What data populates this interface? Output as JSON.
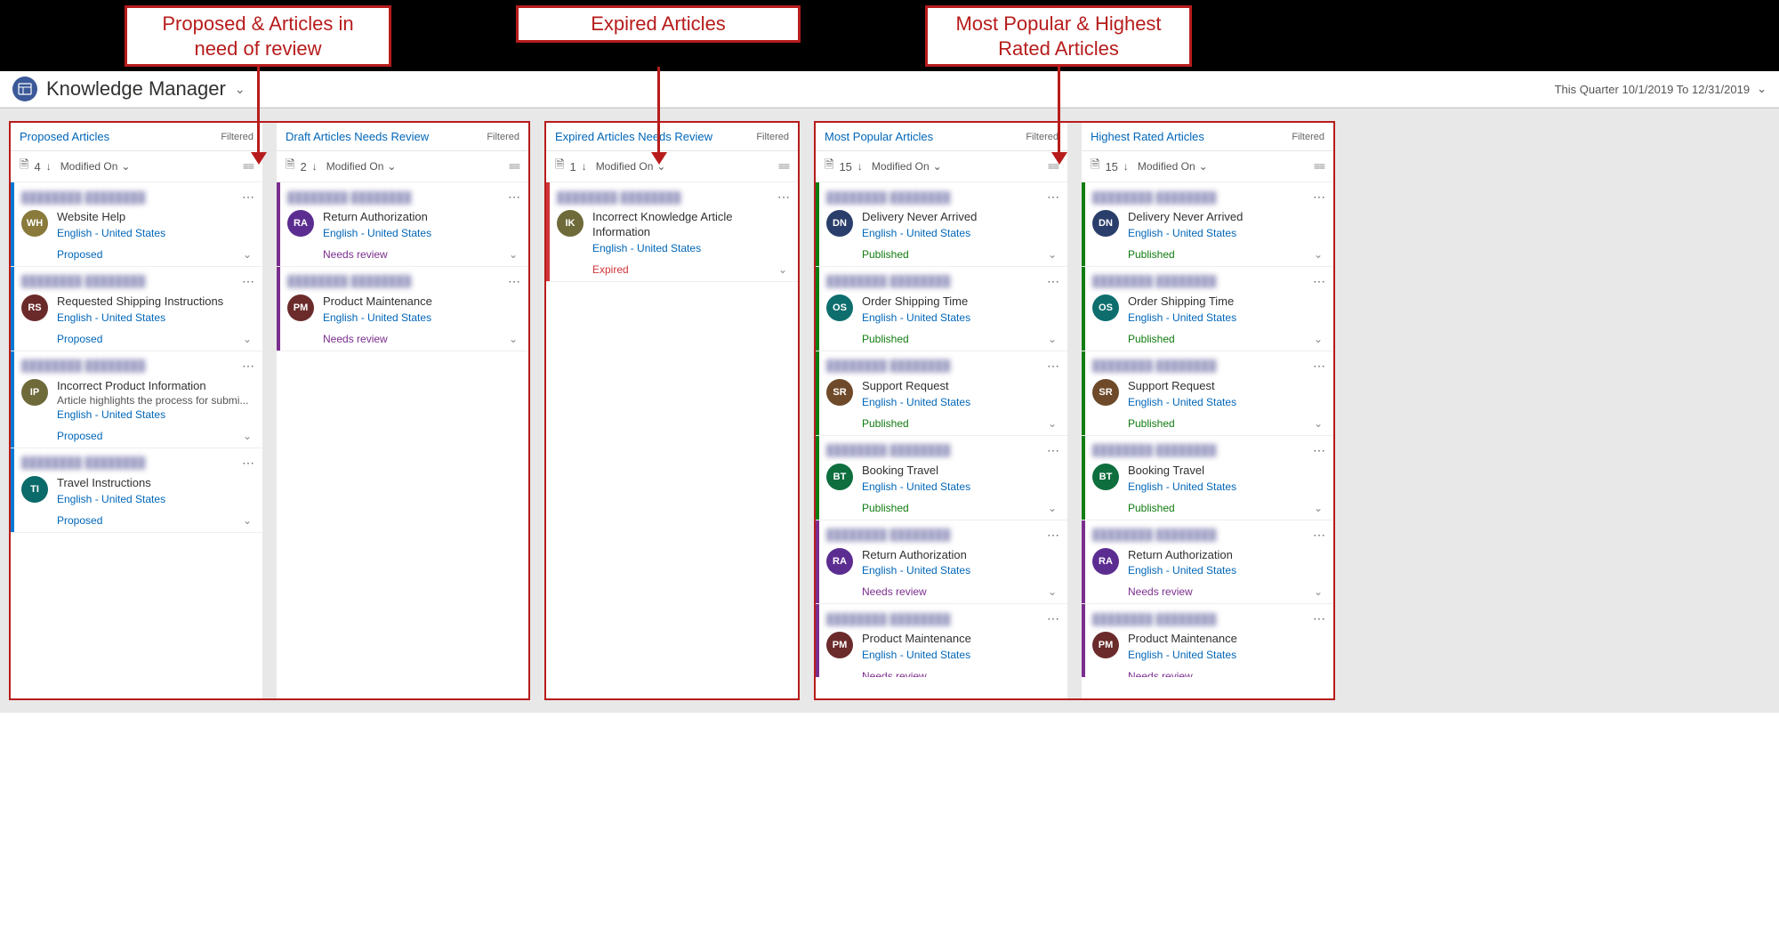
{
  "header": {
    "app_title": "Knowledge Manager",
    "date_filter": "This Quarter 10/1/2019 To 12/31/2019"
  },
  "callouts": {
    "left": "Proposed & Articles in need of review",
    "middle": "Expired Articles",
    "right": "Most Popular & Highest Rated Articles"
  },
  "common": {
    "filtered_label": "Filtered",
    "sort_label": "Modified On",
    "language": "English - United States"
  },
  "status_labels": {
    "proposed": "Proposed",
    "needs_review": "Needs review",
    "expired": "Expired",
    "published": "Published"
  },
  "panels": {
    "proposed": {
      "title": "Proposed Articles",
      "count": "4",
      "cards": [
        {
          "initials": "WH",
          "avatar_class": "av-olive",
          "title": "Website Help",
          "status": "proposed",
          "stripe": "stripe-blue"
        },
        {
          "initials": "RS",
          "avatar_class": "av-darkred",
          "title": "Requested Shipping Instructions",
          "status": "proposed",
          "stripe": "stripe-blue"
        },
        {
          "initials": "IP",
          "avatar_class": "av-drab",
          "title": "Incorrect Product Information",
          "sub": "Article highlights the process for submi...",
          "status": "proposed",
          "stripe": "stripe-blue"
        },
        {
          "initials": "TI",
          "avatar_class": "av-teal",
          "title": "Travel Instructions",
          "status": "proposed",
          "stripe": "stripe-blue"
        }
      ]
    },
    "draft": {
      "title": "Draft Articles Needs Review",
      "count": "2",
      "cards": [
        {
          "initials": "RA",
          "avatar_class": "av-purple",
          "title": "Return Authorization",
          "status": "needs_review",
          "stripe": "stripe-purple"
        },
        {
          "initials": "PM",
          "avatar_class": "av-maroon",
          "title": "Product Maintenance",
          "status": "needs_review",
          "stripe": "stripe-purple"
        }
      ]
    },
    "expired": {
      "title": "Expired Articles Needs Review",
      "count": "1",
      "cards": [
        {
          "initials": "IK",
          "avatar_class": "av-drab",
          "title": "Incorrect Knowledge Article Information",
          "status": "expired",
          "stripe": "stripe-red"
        }
      ]
    },
    "popular": {
      "title": "Most Popular Articles",
      "count": "15",
      "cards": [
        {
          "initials": "DN",
          "avatar_class": "av-navy",
          "title": "Delivery Never Arrived",
          "status": "published",
          "stripe": "stripe-green"
        },
        {
          "initials": "OS",
          "avatar_class": "av-dteal",
          "title": "Order Shipping Time",
          "status": "published",
          "stripe": "stripe-green"
        },
        {
          "initials": "SR",
          "avatar_class": "av-brown",
          "title": "Support Request",
          "status": "published",
          "stripe": "stripe-green"
        },
        {
          "initials": "BT",
          "avatar_class": "av-dgreen",
          "title": "Booking Travel",
          "status": "published",
          "stripe": "stripe-green"
        },
        {
          "initials": "RA",
          "avatar_class": "av-purple",
          "title": "Return Authorization",
          "status": "needs_review",
          "stripe": "stripe-purple"
        },
        {
          "initials": "PM",
          "avatar_class": "av-maroon",
          "title": "Product Maintenance",
          "status": "needs_review",
          "stripe": "stripe-purple"
        }
      ]
    },
    "highest": {
      "title": "Highest Rated Articles",
      "count": "15",
      "cards": [
        {
          "initials": "DN",
          "avatar_class": "av-navy",
          "title": "Delivery Never Arrived",
          "status": "published",
          "stripe": "stripe-green"
        },
        {
          "initials": "OS",
          "avatar_class": "av-dteal",
          "title": "Order Shipping Time",
          "status": "published",
          "stripe": "stripe-green"
        },
        {
          "initials": "SR",
          "avatar_class": "av-brown",
          "title": "Support Request",
          "status": "published",
          "stripe": "stripe-green"
        },
        {
          "initials": "BT",
          "avatar_class": "av-dgreen",
          "title": "Booking Travel",
          "status": "published",
          "stripe": "stripe-green"
        },
        {
          "initials": "RA",
          "avatar_class": "av-purple",
          "title": "Return Authorization",
          "status": "needs_review",
          "stripe": "stripe-purple"
        },
        {
          "initials": "PM",
          "avatar_class": "av-maroon",
          "title": "Product Maintenance",
          "status": "needs_review",
          "stripe": "stripe-purple"
        }
      ]
    }
  }
}
